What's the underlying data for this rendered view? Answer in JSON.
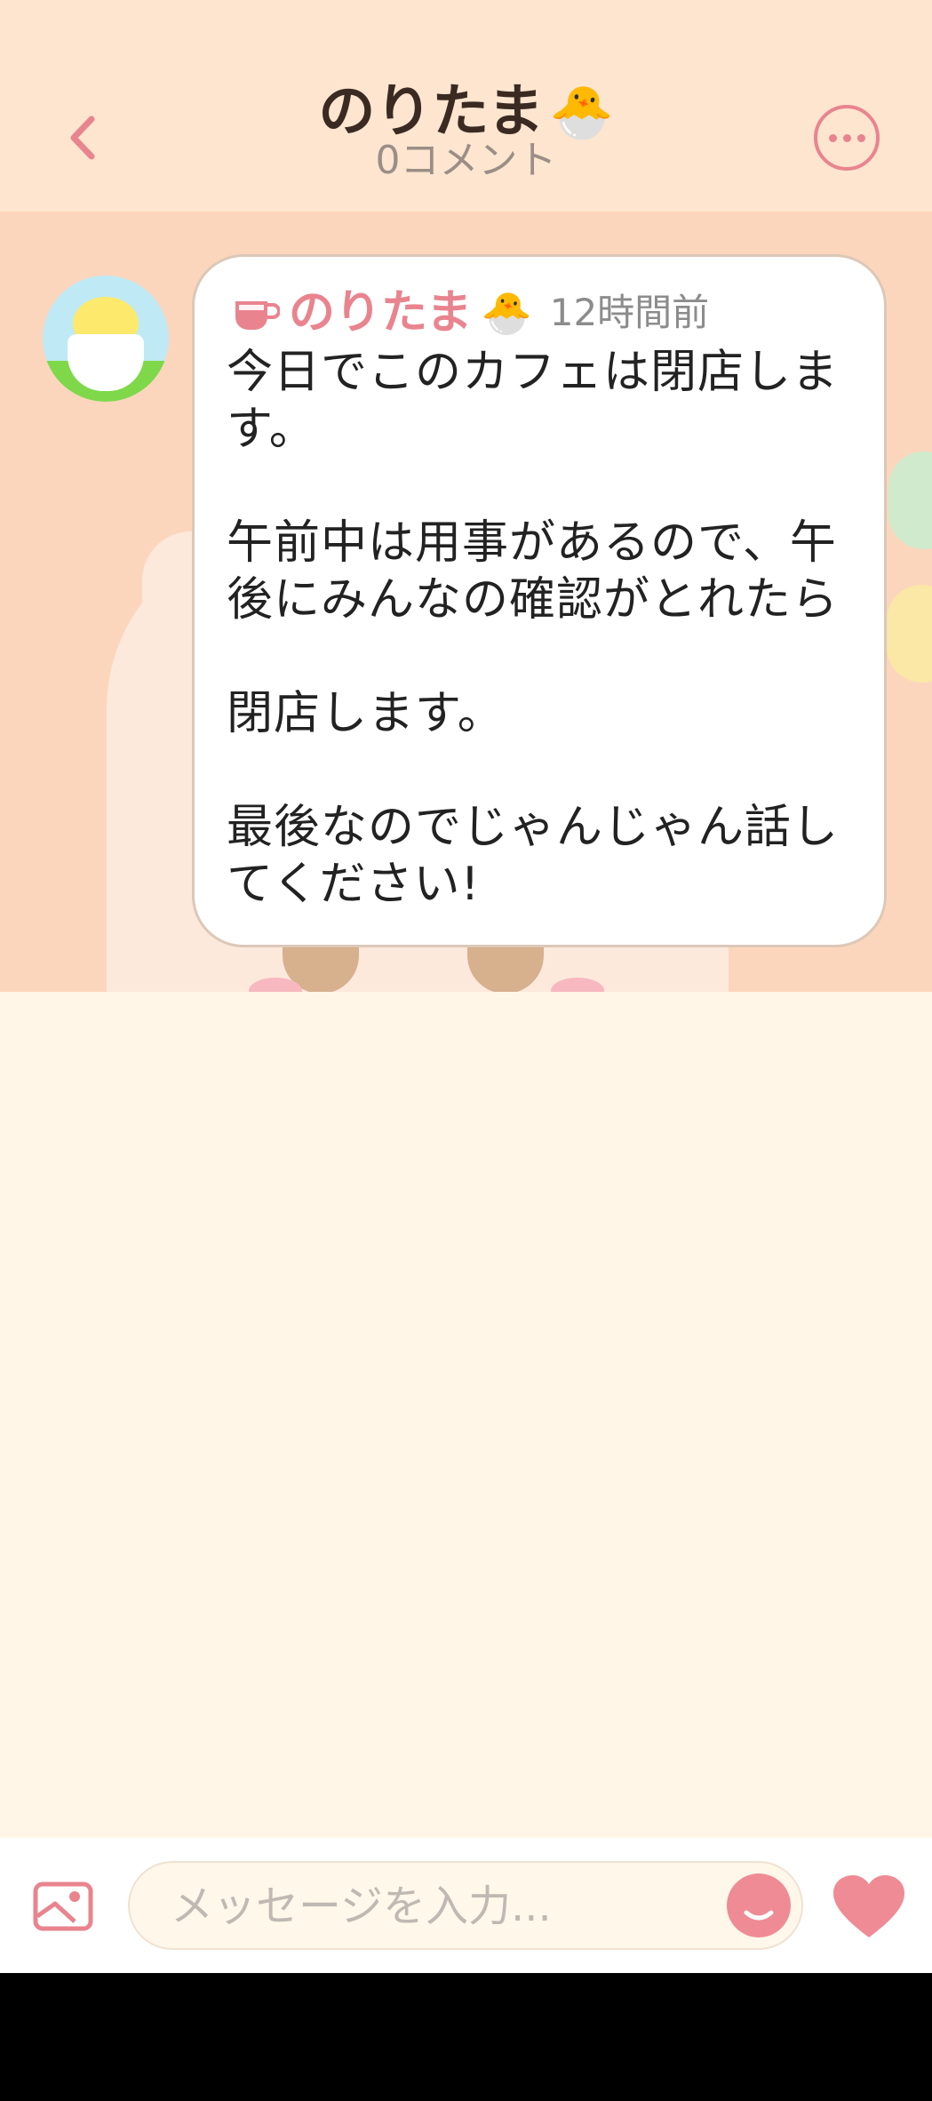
{
  "header": {
    "title": "のりたま",
    "title_emoji": "🐣",
    "subtitle": "0コメント",
    "back_icon": "chevron-left-icon",
    "more_icon": "more-horizontal-icon"
  },
  "post": {
    "author": "のりたま",
    "author_emoji": "🐣",
    "time": "12時間前",
    "role_icon": "teacup-icon",
    "message": "今日でこのカフェは閉店しま\nす。\n\n午前中は用事があるので、午\n後にみんなの確認がとれたら\n\n閉店します。\n\n最後なのでじゃんじゃん話し\nてください!"
  },
  "composer": {
    "placeholder": "メッセージを入力...",
    "image_icon": "image-icon",
    "emoji_icon": "smile-icon",
    "send_icon": "heart-icon"
  },
  "colors": {
    "accent": "#e9848f",
    "header_bg": "#fde5cf",
    "banner_bg": "#fcd6bc",
    "page_bg": "#fff6e8"
  }
}
